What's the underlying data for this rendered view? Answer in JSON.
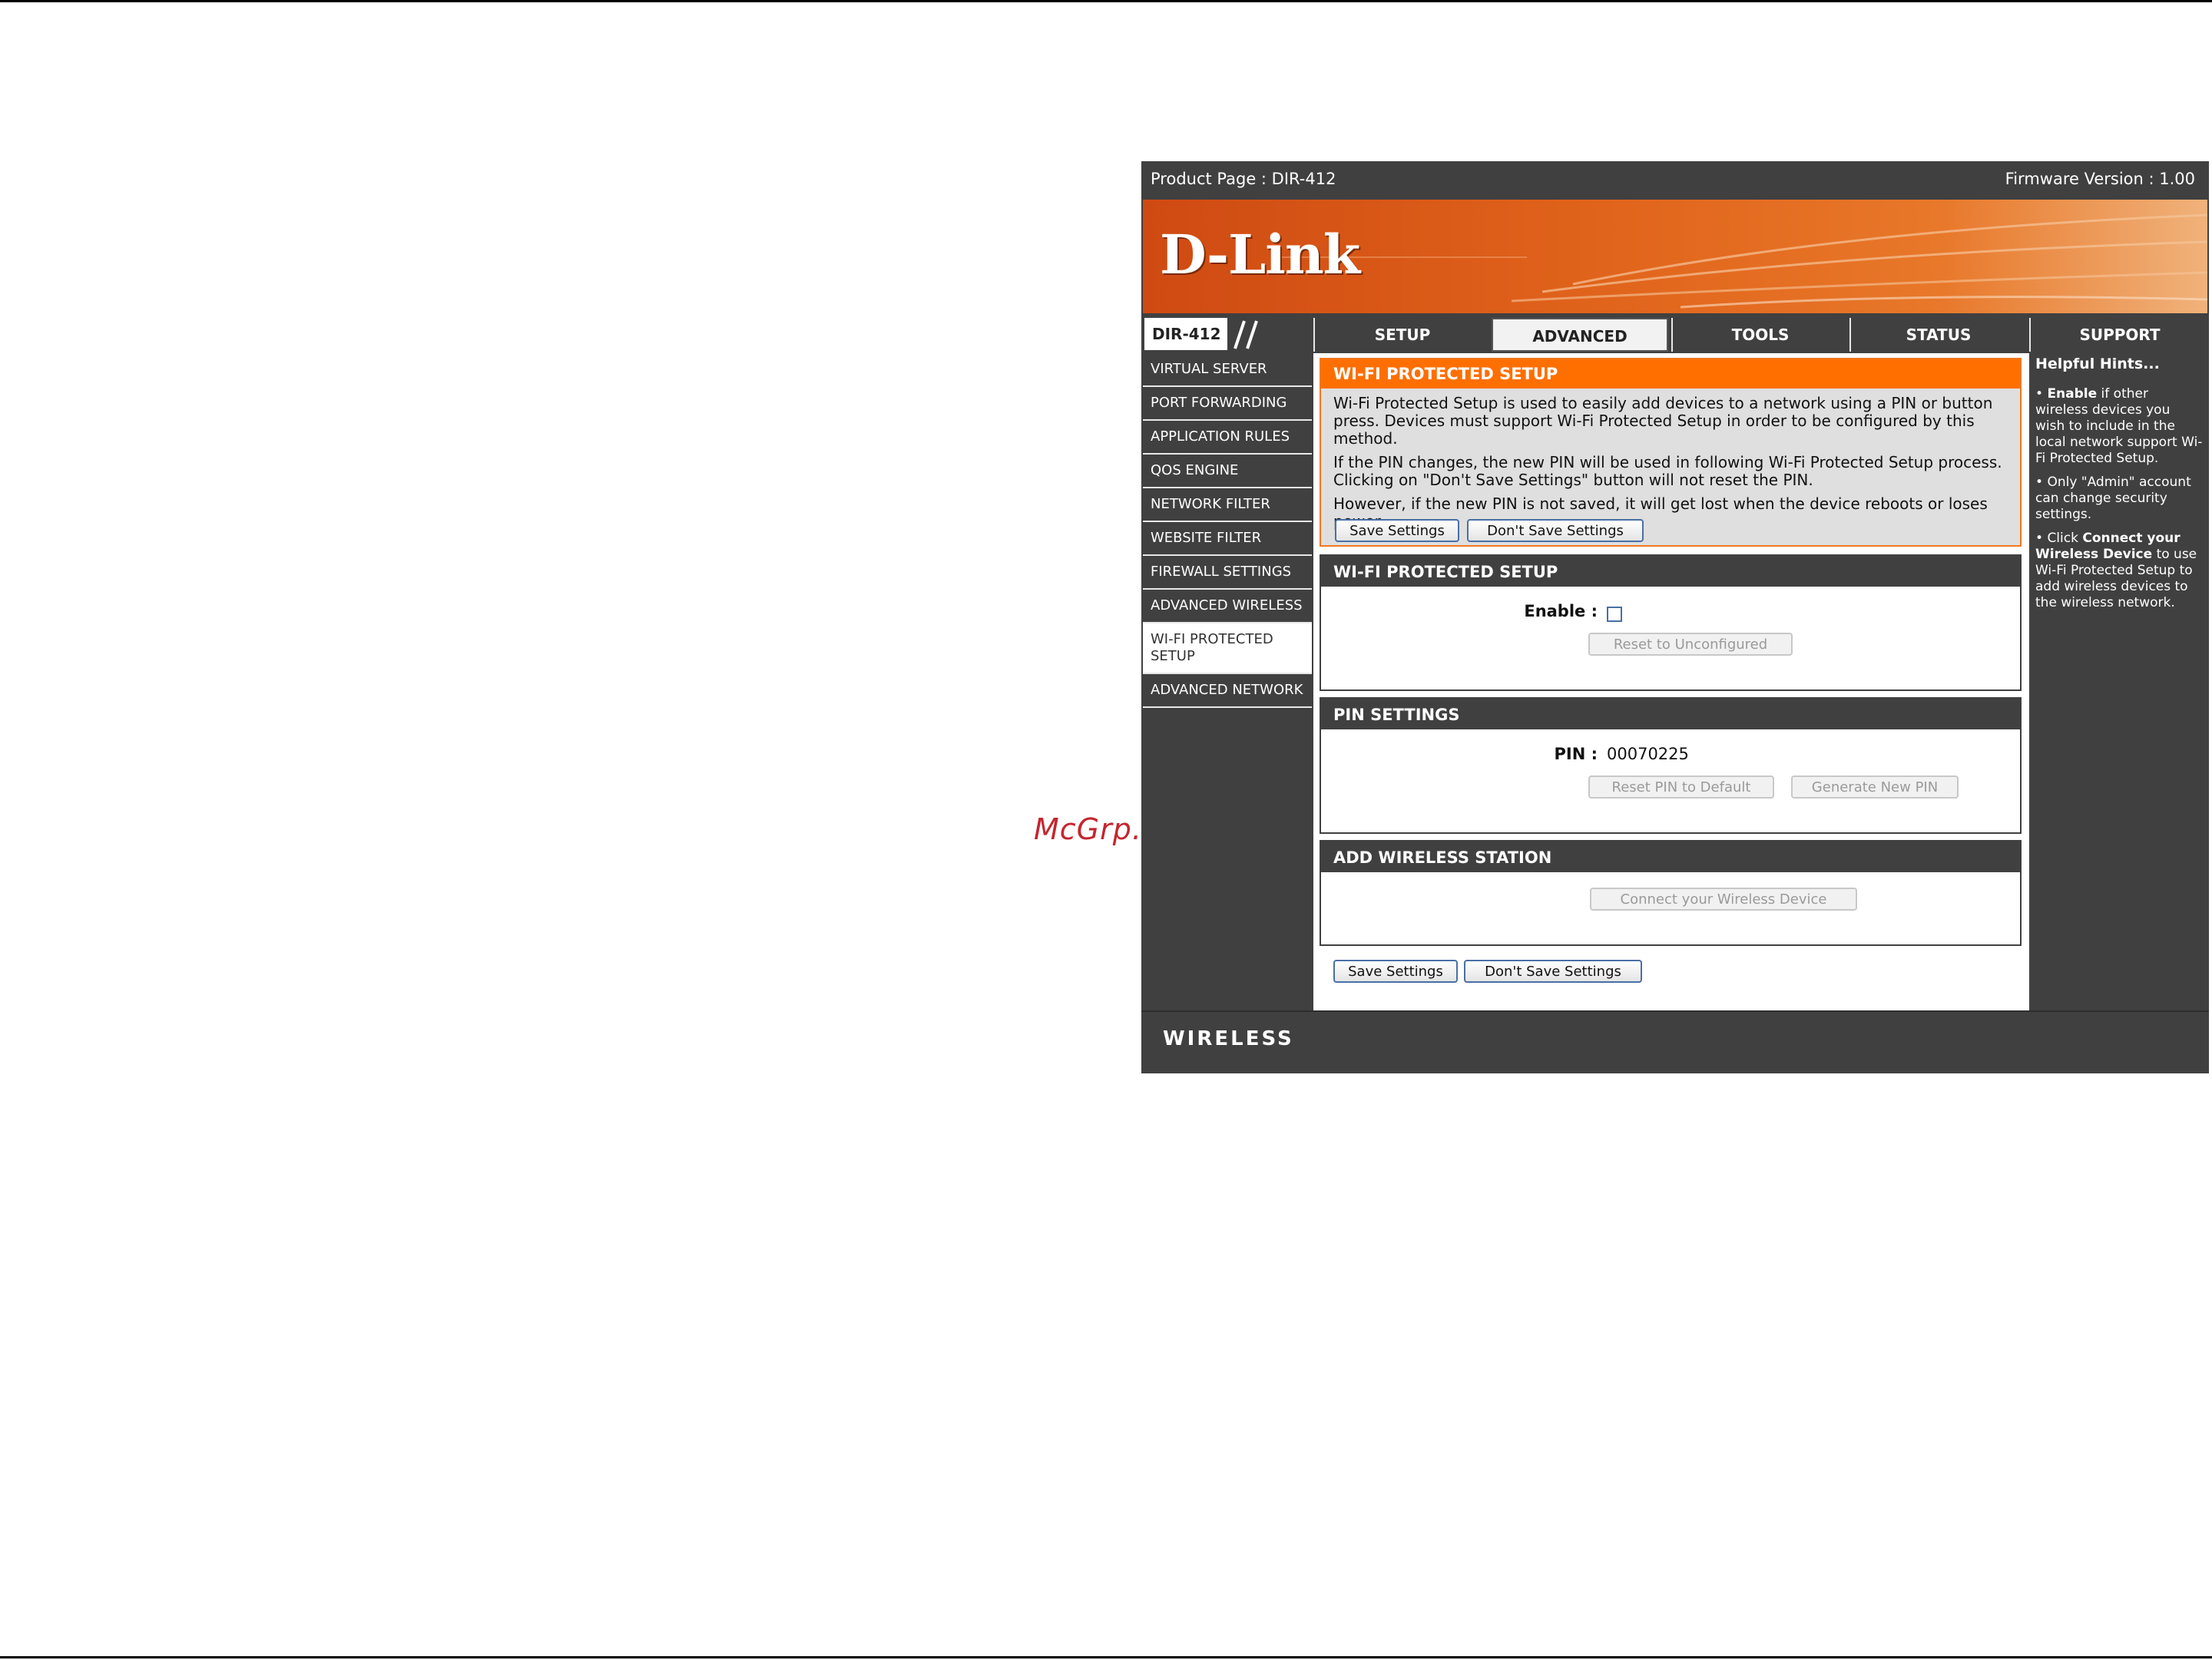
{
  "watermark": "McGrp.Ru",
  "topbar": {
    "product": "Product Page : DIR-412",
    "firmware": "Firmware Version : 1.00"
  },
  "logo": "D-Link",
  "model": "DIR-412",
  "tabs": [
    {
      "label": "SETUP"
    },
    {
      "label": "ADVANCED"
    },
    {
      "label": "TOOLS"
    },
    {
      "label": "STATUS"
    },
    {
      "label": "SUPPORT"
    }
  ],
  "sidenav": [
    "VIRTUAL SERVER",
    "PORT FORWARDING",
    "APPLICATION RULES",
    "QOS ENGINE",
    "NETWORK FILTER",
    "WEBSITE FILTER",
    "FIREWALL SETTINGS",
    "ADVANCED WIRELESS",
    "WI-FI PROTECTED SETUP",
    "ADVANCED NETWORK"
  ],
  "intro": {
    "title": "WI-FI PROTECTED SETUP",
    "p1": "Wi-Fi Protected Setup is used to easily add devices to a network using a PIN or button press. Devices must support Wi-Fi Protected Setup in order to be configured by this method.",
    "p2": "If the PIN changes, the new PIN will be used in following Wi-Fi Protected Setup process. Clicking on \"Don't Save Settings\" button will not reset the PIN.",
    "p3": "However, if the new PIN is not saved, it will get lost when the device reboots or loses power.",
    "save": "Save Settings",
    "dont_save": "Don't Save Settings"
  },
  "wps": {
    "title": "WI-FI PROTECTED SETUP",
    "enable_label": "Enable :",
    "reset_button": "Reset to Unconfigured"
  },
  "pin": {
    "title": "PIN SETTINGS",
    "label": "PIN :",
    "value": "00070225",
    "reset_button": "Reset PIN to Default",
    "generate_button": "Generate New PIN"
  },
  "station": {
    "title": "ADD WIRELESS STATION",
    "connect_button": "Connect your Wireless Device"
  },
  "bottom_buttons": {
    "save": "Save Settings",
    "dont_save": "Don't Save Settings"
  },
  "hints": {
    "title": "Helpful Hints...",
    "h1_bold": "Enable",
    "h1_rest": " if other wireless devices you wish to include in the local network support Wi-Fi Protected Setup.",
    "h2": "Only \"Admin\" account can change security settings.",
    "h3_pre": "Click ",
    "h3_bold": "Connect your Wireless Device",
    "h3_rest": " to use Wi-Fi Protected Setup to add wireless devices to the wireless network."
  },
  "footer": "WIRELESS"
}
